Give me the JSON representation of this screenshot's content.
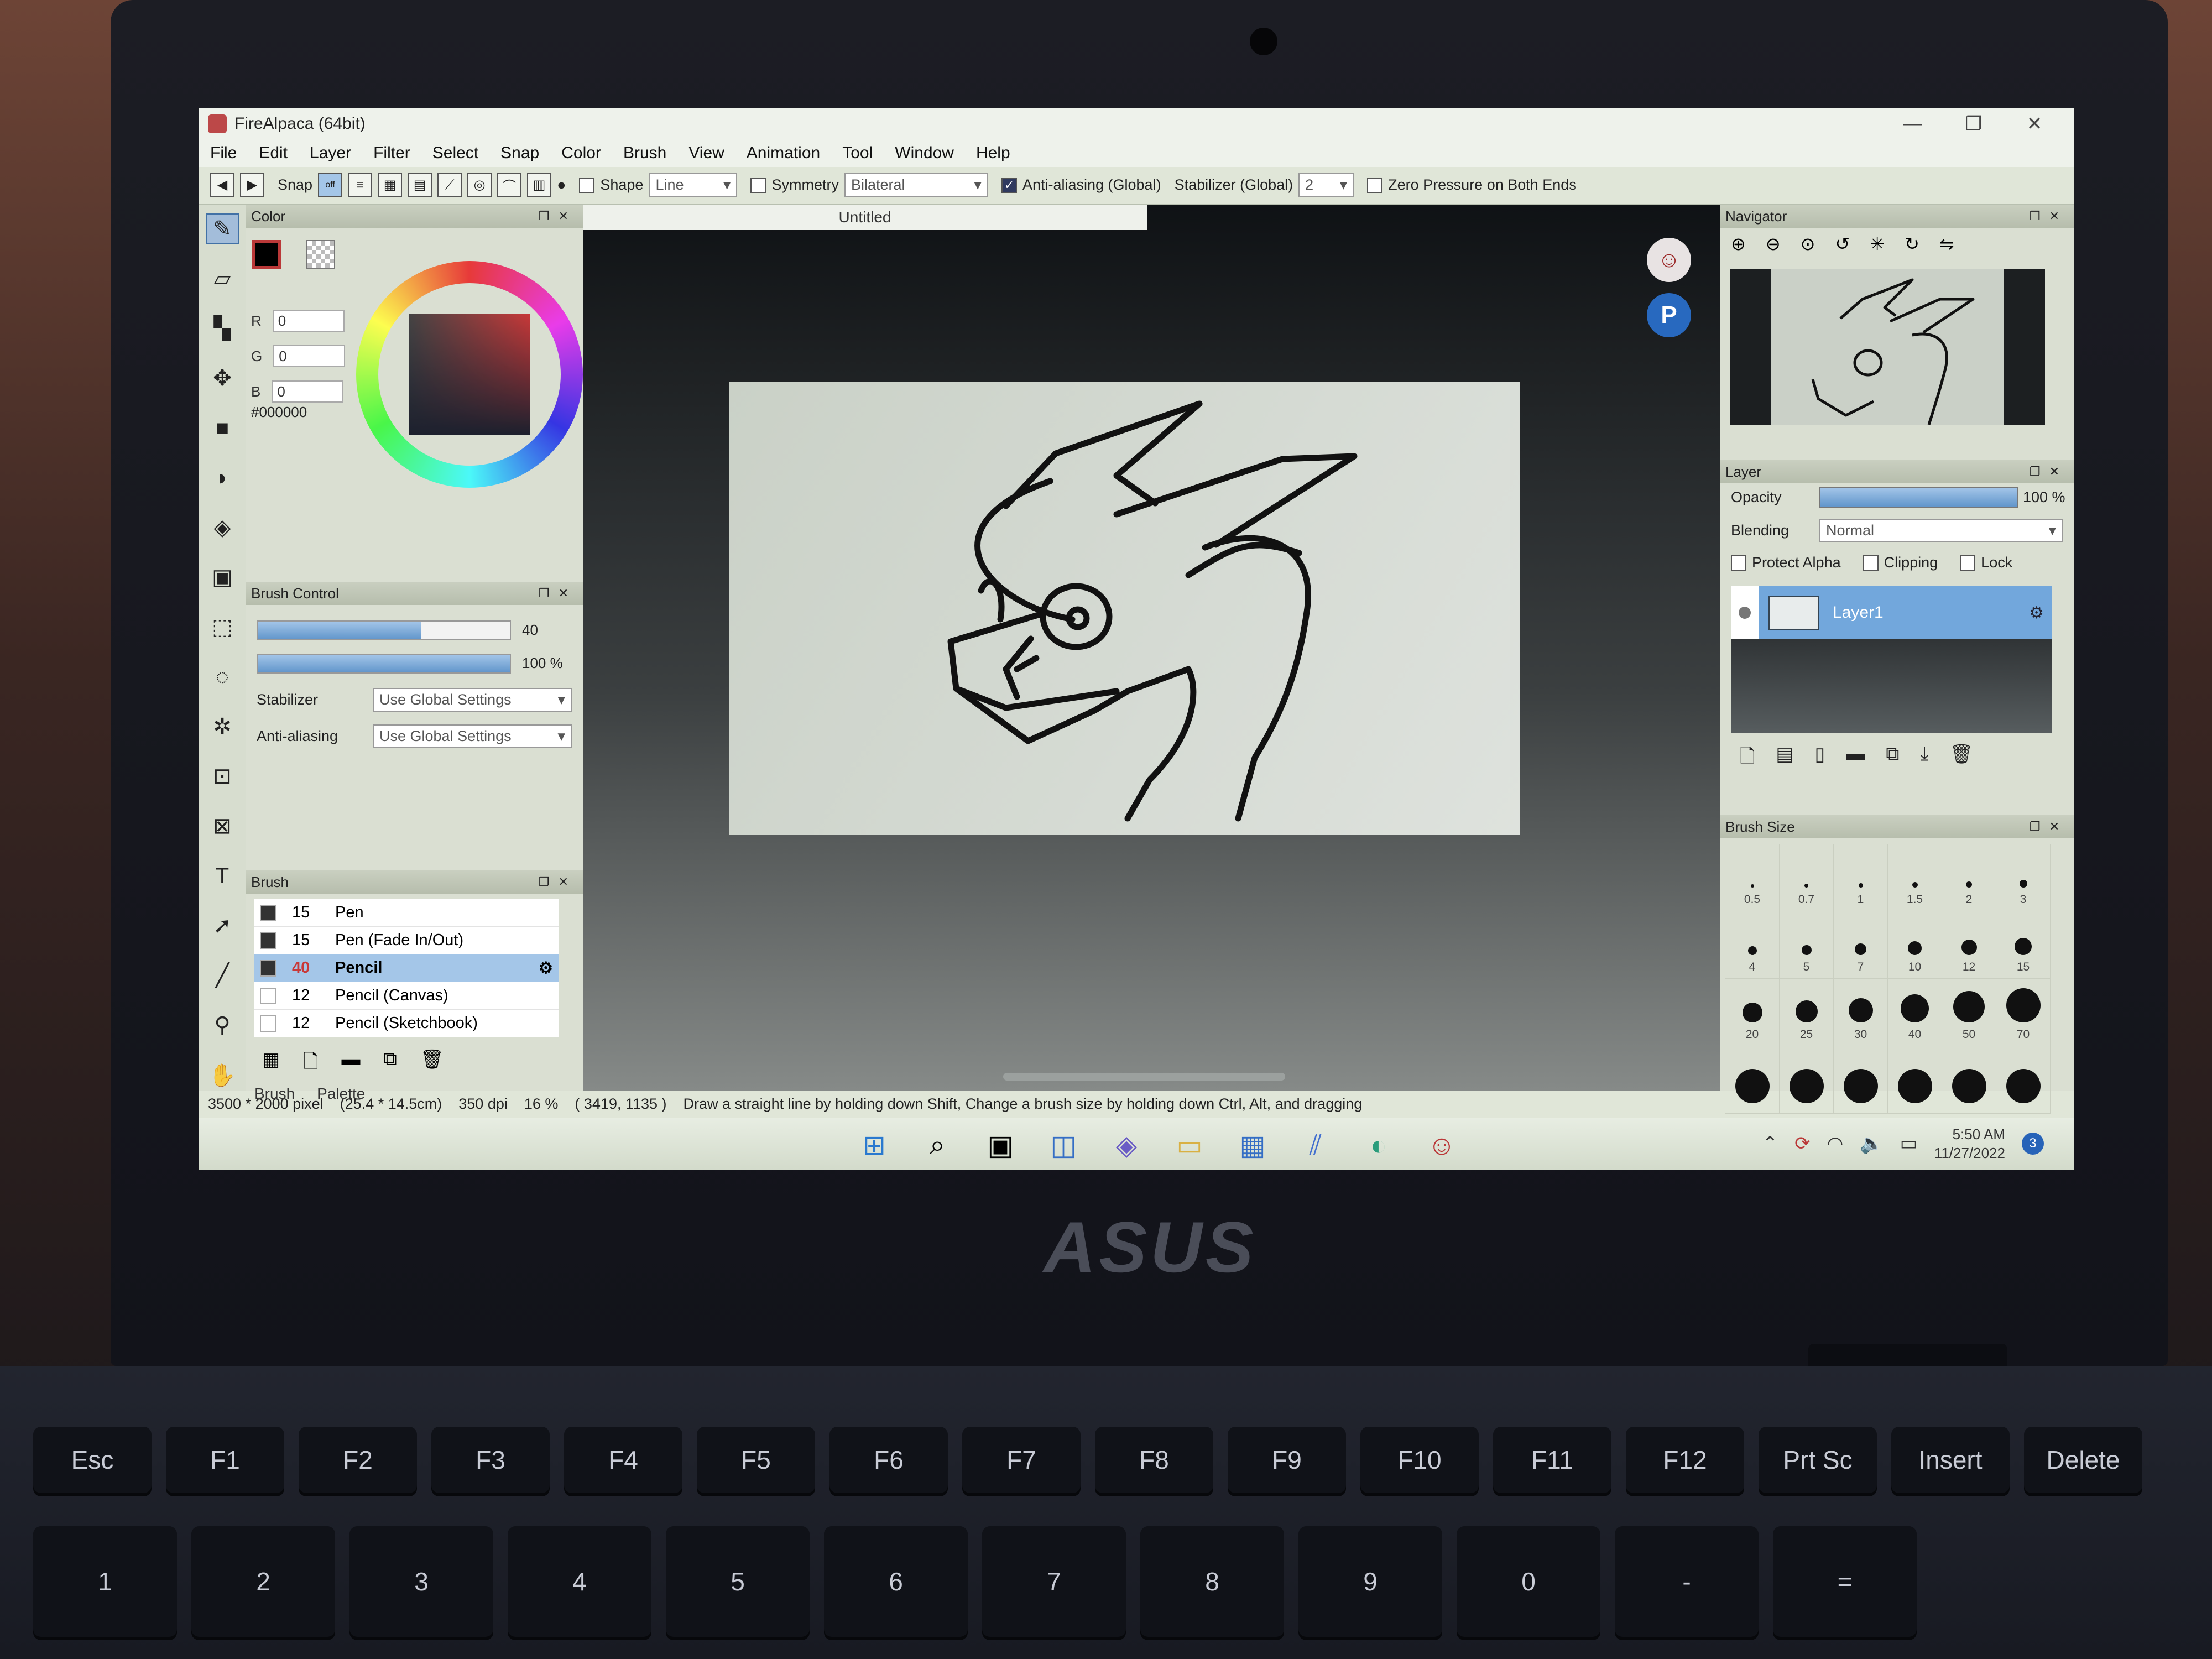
{
  "window": {
    "title": "FireAlpaca (64bit)",
    "minimize": "—",
    "restore": "❐",
    "close": "✕"
  },
  "menu": [
    "File",
    "Edit",
    "Layer",
    "Filter",
    "Select",
    "Snap",
    "Color",
    "Brush",
    "View",
    "Animation",
    "Tool",
    "Window",
    "Help"
  ],
  "toolbar": {
    "snap_label": "Snap",
    "snap_off": "off",
    "shape_label": "Shape",
    "shape_value": "Line",
    "symmetry_label": "Symmetry",
    "symmetry_value": "Bilateral",
    "antialias_label": "Anti-aliasing (Global)",
    "stabilizer_label": "Stabilizer (Global)",
    "stabilizer_value": "2",
    "zero_pressure_label": "Zero Pressure on Both Ends"
  },
  "color_panel": {
    "title": "Color",
    "r_label": "R",
    "r_value": "0",
    "g_label": "G",
    "g_value": "0",
    "b_label": "B",
    "b_value": "0",
    "hex": "#000000"
  },
  "brush_control": {
    "title": "Brush Control",
    "size_value": "40",
    "size_fraction": 0.65,
    "opacity_value": "100 %",
    "opacity_fraction": 1.0,
    "stabilizer_label": "Stabilizer",
    "stabilizer_value": "Use Global Settings",
    "antialias_label": "Anti-aliasing",
    "antialias_value": "Use Global Settings"
  },
  "brush_panel": {
    "title": "Brush",
    "items": [
      {
        "size": "15",
        "name": "Pen"
      },
      {
        "size": "15",
        "name": "Pen (Fade In/Out)"
      },
      {
        "size": "40",
        "name": "Pencil"
      },
      {
        "size": "12",
        "name": "Pencil (Canvas)"
      },
      {
        "size": "12",
        "name": "Pencil (Sketchbook)"
      }
    ],
    "selected_index": 2,
    "tab_brush": "Brush",
    "tab_palette": "Palette"
  },
  "document": {
    "tab_title": "Untitled"
  },
  "navigator": {
    "title": "Navigator"
  },
  "layer_panel": {
    "title": "Layer",
    "opacity_label": "Opacity",
    "opacity_value": "100 %",
    "blending_label": "Blending",
    "blending_value": "Normal",
    "protect_alpha": "Protect Alpha",
    "clipping": "Clipping",
    "lock": "Lock",
    "layer_name": "Layer1"
  },
  "brush_size_panel": {
    "title": "Brush Size",
    "sizes": [
      "0.5",
      "0.7",
      "1",
      "1.5",
      "2",
      "3",
      "4",
      "5",
      "7",
      "10",
      "12",
      "15",
      "20",
      "25",
      "30",
      "40",
      "50",
      "70",
      "",
      "",
      "",
      "",
      "",
      ""
    ]
  },
  "status_bar": {
    "dimensions": "3500 * 2000 pixel",
    "physical": "(25.4 * 14.5cm)",
    "dpi": "350 dpi",
    "zoom": "16 %",
    "cursor": "( 3419, 1135 )",
    "hint": "Draw a straight line by holding down Shift, Change a brush size by holding down Ctrl, Alt, and dragging"
  },
  "taskbar": {
    "time": "5:50 AM",
    "date": "11/27/2022",
    "notifications": "3"
  },
  "hardware": {
    "brand": "ASUS",
    "fn_keys": [
      "Esc",
      "F1",
      "F2",
      "F3",
      "F4",
      "F5",
      "F6",
      "F7",
      "F8",
      "F9",
      "F10",
      "F11",
      "F12",
      "Prt Sc",
      "Insert",
      "Delete"
    ],
    "number_keys": [
      "1",
      "2",
      "3",
      "4",
      "5",
      "6",
      "7",
      "8",
      "9",
      "0",
      "-",
      "="
    ]
  }
}
